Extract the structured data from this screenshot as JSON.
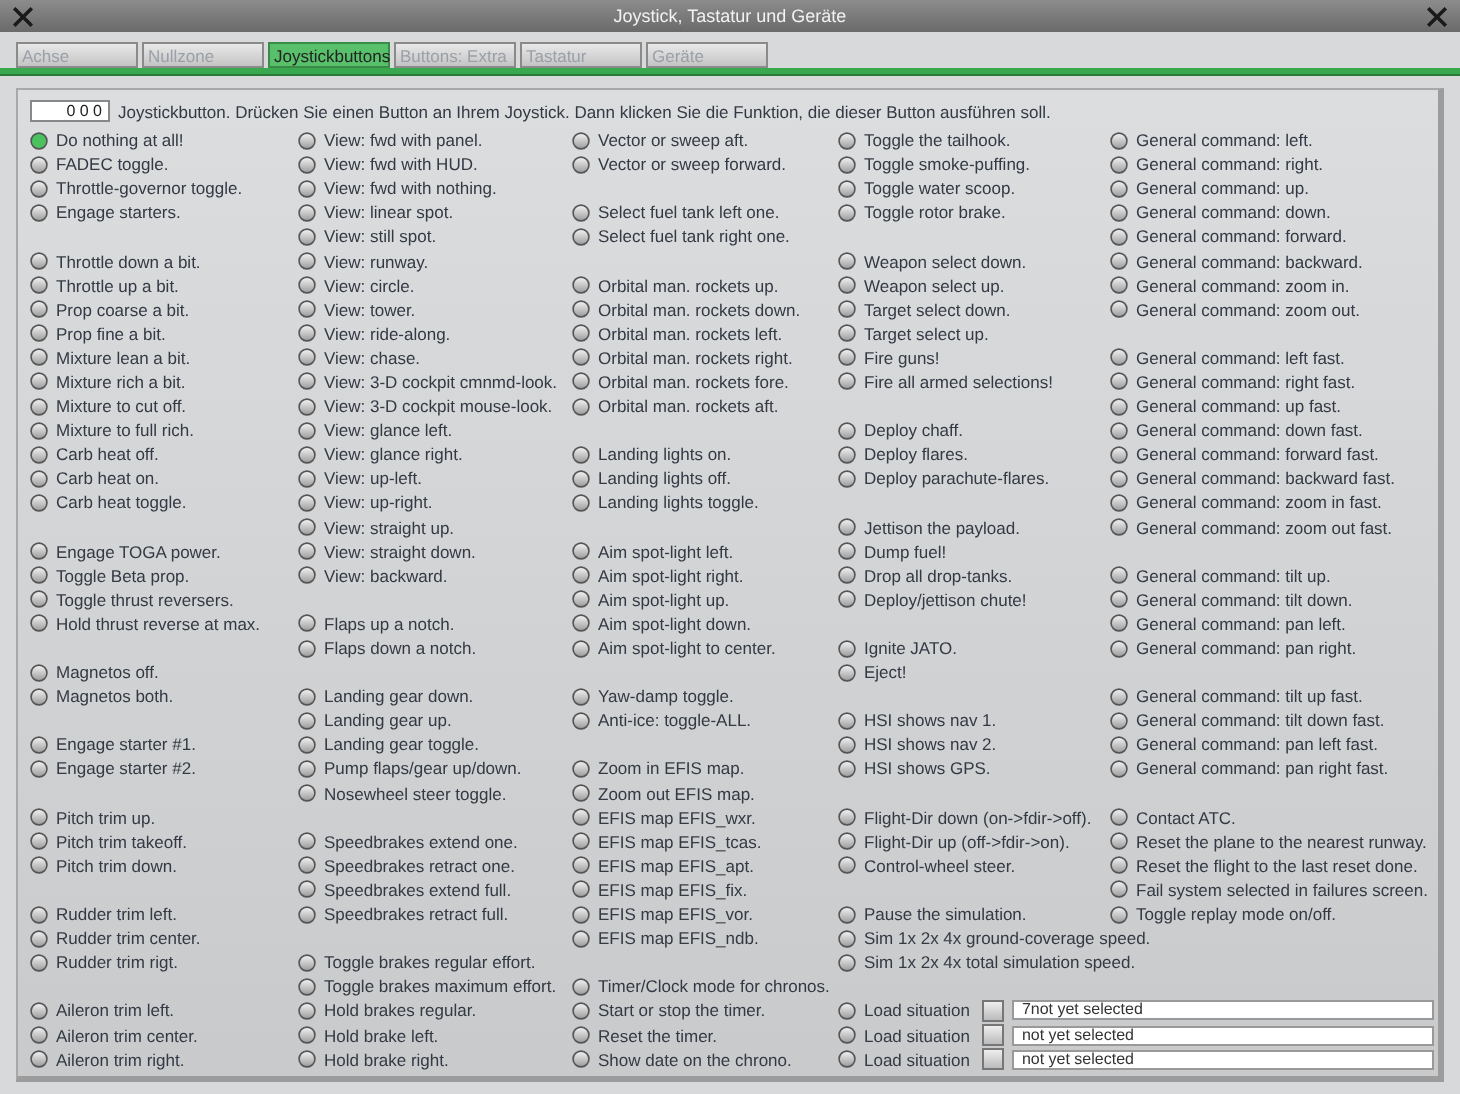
{
  "window": {
    "title": "Joystick, Tastatur und Geräte"
  },
  "tabs": [
    {
      "label": "Achse",
      "selected": false
    },
    {
      "label": "Nullzone",
      "selected": false
    },
    {
      "label": "Joystickbuttons",
      "selected": true
    },
    {
      "label": "Buttons: Extra",
      "selected": false
    },
    {
      "label": "Tastatur",
      "selected": false
    },
    {
      "label": "Geräte",
      "selected": false
    }
  ],
  "button_field": {
    "value": "0 0 0"
  },
  "instruction": "Joystickbutton. Drücken Sie einen Button an Ihrem Joystick. Dann klicken Sie die Funktion, die dieser Button ausführen soll.",
  "columns": [
    {
      "items": [
        {
          "kind": "option",
          "label": "Do nothing at all!",
          "selected": true
        },
        {
          "kind": "option",
          "label": "FADEC toggle.",
          "selected": false
        },
        {
          "kind": "option",
          "label": "Throttle-governor toggle.",
          "selected": false
        },
        {
          "kind": "option",
          "label": "Engage starters.",
          "selected": false
        },
        {
          "kind": "gap"
        },
        {
          "kind": "option",
          "label": "Throttle down a bit.",
          "selected": false
        },
        {
          "kind": "option",
          "label": "Throttle up a bit.",
          "selected": false
        },
        {
          "kind": "option",
          "label": "Prop coarse a bit.",
          "selected": false
        },
        {
          "kind": "option",
          "label": "Prop fine a bit.",
          "selected": false
        },
        {
          "kind": "option",
          "label": "Mixture lean a bit.",
          "selected": false
        },
        {
          "kind": "option",
          "label": "Mixture rich a bit.",
          "selected": false
        },
        {
          "kind": "option",
          "label": "Mixture to cut off.",
          "selected": false
        },
        {
          "kind": "option",
          "label": "Mixture to full rich.",
          "selected": false
        },
        {
          "kind": "option",
          "label": "Carb heat off.",
          "selected": false
        },
        {
          "kind": "option",
          "label": "Carb heat on.",
          "selected": false
        },
        {
          "kind": "option",
          "label": "Carb heat toggle.",
          "selected": false
        },
        {
          "kind": "gap"
        },
        {
          "kind": "option",
          "label": "Engage TOGA power.",
          "selected": false
        },
        {
          "kind": "option",
          "label": "Toggle Beta prop.",
          "selected": false
        },
        {
          "kind": "option",
          "label": "Toggle thrust reversers.",
          "selected": false
        },
        {
          "kind": "option",
          "label": "Hold thrust reverse at max.",
          "selected": false
        },
        {
          "kind": "gap"
        },
        {
          "kind": "option",
          "label": "Magnetos off.",
          "selected": false
        },
        {
          "kind": "option",
          "label": "Magnetos both.",
          "selected": false
        },
        {
          "kind": "gap"
        },
        {
          "kind": "option",
          "label": "Engage starter #1.",
          "selected": false
        },
        {
          "kind": "option",
          "label": "Engage starter #2.",
          "selected": false
        },
        {
          "kind": "gap"
        },
        {
          "kind": "option",
          "label": "Pitch trim up.",
          "selected": false
        },
        {
          "kind": "option",
          "label": "Pitch trim takeoff.",
          "selected": false
        },
        {
          "kind": "option",
          "label": "Pitch trim down.",
          "selected": false
        },
        {
          "kind": "gap"
        },
        {
          "kind": "option",
          "label": "Rudder trim left.",
          "selected": false
        },
        {
          "kind": "option",
          "label": "Rudder trim center.",
          "selected": false
        },
        {
          "kind": "option",
          "label": "Rudder trim rigt.",
          "selected": false
        },
        {
          "kind": "gap"
        },
        {
          "kind": "option",
          "label": "Aileron trim left.",
          "selected": false
        },
        {
          "kind": "option",
          "label": "Aileron trim center.",
          "selected": false
        },
        {
          "kind": "option",
          "label": "Aileron trim right.",
          "selected": false
        }
      ]
    },
    {
      "items": [
        {
          "kind": "option",
          "label": "View: fwd with panel.",
          "selected": false
        },
        {
          "kind": "option",
          "label": "View: fwd with HUD.",
          "selected": false
        },
        {
          "kind": "option",
          "label": "View: fwd with nothing.",
          "selected": false
        },
        {
          "kind": "option",
          "label": "View: linear spot.",
          "selected": false
        },
        {
          "kind": "option",
          "label": "View: still spot.",
          "selected": false
        },
        {
          "kind": "option",
          "label": "View: runway.",
          "selected": false
        },
        {
          "kind": "option",
          "label": "View: circle.",
          "selected": false
        },
        {
          "kind": "option",
          "label": "View: tower.",
          "selected": false
        },
        {
          "kind": "option",
          "label": "View: ride-along.",
          "selected": false
        },
        {
          "kind": "option",
          "label": "View: chase.",
          "selected": false
        },
        {
          "kind": "option",
          "label": "View: 3-D cockpit cmnmd-look.",
          "selected": false
        },
        {
          "kind": "option",
          "label": "View: 3-D cockpit mouse-look.",
          "selected": false
        },
        {
          "kind": "option",
          "label": "View: glance left.",
          "selected": false
        },
        {
          "kind": "option",
          "label": "View: glance right.",
          "selected": false
        },
        {
          "kind": "option",
          "label": "View: up-left.",
          "selected": false
        },
        {
          "kind": "option",
          "label": "View: up-right.",
          "selected": false
        },
        {
          "kind": "option",
          "label": "View: straight up.",
          "selected": false
        },
        {
          "kind": "option",
          "label": "View: straight down.",
          "selected": false
        },
        {
          "kind": "option",
          "label": "View: backward.",
          "selected": false
        },
        {
          "kind": "gap"
        },
        {
          "kind": "option",
          "label": "Flaps up a notch.",
          "selected": false
        },
        {
          "kind": "option",
          "label": "Flaps down a notch.",
          "selected": false
        },
        {
          "kind": "gap"
        },
        {
          "kind": "option",
          "label": "Landing gear down.",
          "selected": false
        },
        {
          "kind": "option",
          "label": "Landing gear up.",
          "selected": false
        },
        {
          "kind": "option",
          "label": "Landing gear toggle.",
          "selected": false
        },
        {
          "kind": "option",
          "label": "Pump flaps/gear up/down.",
          "selected": false
        },
        {
          "kind": "option",
          "label": "Nosewheel steer toggle.",
          "selected": false
        },
        {
          "kind": "gap"
        },
        {
          "kind": "option",
          "label": "Speedbrakes extend one.",
          "selected": false
        },
        {
          "kind": "option",
          "label": "Speedbrakes retract one.",
          "selected": false
        },
        {
          "kind": "option",
          "label": "Speedbrakes extend full.",
          "selected": false
        },
        {
          "kind": "option",
          "label": "Speedbrakes retract full.",
          "selected": false
        },
        {
          "kind": "gap"
        },
        {
          "kind": "option",
          "label": "Toggle brakes regular effort.",
          "selected": false
        },
        {
          "kind": "option",
          "label": "Toggle brakes maximum effort.",
          "selected": false
        },
        {
          "kind": "option",
          "label": "Hold brakes regular.",
          "selected": false
        },
        {
          "kind": "option",
          "label": "Hold brake left.",
          "selected": false
        },
        {
          "kind": "option",
          "label": "Hold brake right.",
          "selected": false
        }
      ]
    },
    {
      "items": [
        {
          "kind": "option",
          "label": "Vector or sweep aft.",
          "selected": false
        },
        {
          "kind": "option",
          "label": "Vector or sweep forward.",
          "selected": false
        },
        {
          "kind": "gap"
        },
        {
          "kind": "option",
          "label": "Select fuel tank left one.",
          "selected": false
        },
        {
          "kind": "option",
          "label": "Select fuel tank right one.",
          "selected": false
        },
        {
          "kind": "gap"
        },
        {
          "kind": "option",
          "label": "Orbital man. rockets up.",
          "selected": false
        },
        {
          "kind": "option",
          "label": "Orbital man. rockets down.",
          "selected": false
        },
        {
          "kind": "option",
          "label": "Orbital man. rockets left.",
          "selected": false
        },
        {
          "kind": "option",
          "label": "Orbital man. rockets right.",
          "selected": false
        },
        {
          "kind": "option",
          "label": "Orbital man. rockets fore.",
          "selected": false
        },
        {
          "kind": "option",
          "label": "Orbital man. rockets aft.",
          "selected": false
        },
        {
          "kind": "gap"
        },
        {
          "kind": "option",
          "label": "Landing lights on.",
          "selected": false
        },
        {
          "kind": "option",
          "label": "Landing lights off.",
          "selected": false
        },
        {
          "kind": "option",
          "label": "Landing lights toggle.",
          "selected": false
        },
        {
          "kind": "gap"
        },
        {
          "kind": "option",
          "label": "Aim spot-light left.",
          "selected": false
        },
        {
          "kind": "option",
          "label": "Aim spot-light right.",
          "selected": false
        },
        {
          "kind": "option",
          "label": "Aim spot-light up.",
          "selected": false
        },
        {
          "kind": "option",
          "label": "Aim spot-light down.",
          "selected": false
        },
        {
          "kind": "option",
          "label": "Aim spot-light to center.",
          "selected": false
        },
        {
          "kind": "gap"
        },
        {
          "kind": "option",
          "label": "Yaw-damp toggle.",
          "selected": false
        },
        {
          "kind": "option",
          "label": "Anti-ice: toggle-ALL.",
          "selected": false
        },
        {
          "kind": "gap"
        },
        {
          "kind": "option",
          "label": "Zoom in EFIS map.",
          "selected": false
        },
        {
          "kind": "option",
          "label": "Zoom out EFIS map.",
          "selected": false
        },
        {
          "kind": "option",
          "label": "EFIS map EFIS_wxr.",
          "selected": false
        },
        {
          "kind": "option",
          "label": "EFIS map EFIS_tcas.",
          "selected": false
        },
        {
          "kind": "option",
          "label": "EFIS map EFIS_apt.",
          "selected": false
        },
        {
          "kind": "option",
          "label": "EFIS map EFIS_fix.",
          "selected": false
        },
        {
          "kind": "option",
          "label": "EFIS map EFIS_vor.",
          "selected": false
        },
        {
          "kind": "option",
          "label": "EFIS map EFIS_ndb.",
          "selected": false
        },
        {
          "kind": "gap"
        },
        {
          "kind": "option",
          "label": "Timer/Clock mode for chronos.",
          "selected": false
        },
        {
          "kind": "option",
          "label": "Start or stop the timer.",
          "selected": false
        },
        {
          "kind": "option",
          "label": "Reset the timer.",
          "selected": false
        },
        {
          "kind": "option",
          "label": "Show date on the chrono.",
          "selected": false
        }
      ]
    },
    {
      "items": [
        {
          "kind": "option",
          "label": "Toggle the tailhook.",
          "selected": false
        },
        {
          "kind": "option",
          "label": "Toggle smoke-puffing.",
          "selected": false
        },
        {
          "kind": "option",
          "label": "Toggle water scoop.",
          "selected": false
        },
        {
          "kind": "option",
          "label": "Toggle rotor brake.",
          "selected": false
        },
        {
          "kind": "gap"
        },
        {
          "kind": "option",
          "label": "Weapon select down.",
          "selected": false
        },
        {
          "kind": "option",
          "label": "Weapon select up.",
          "selected": false
        },
        {
          "kind": "option",
          "label": "Target select down.",
          "selected": false
        },
        {
          "kind": "option",
          "label": "Target select up.",
          "selected": false
        },
        {
          "kind": "option",
          "label": "Fire guns!",
          "selected": false
        },
        {
          "kind": "option",
          "label": "Fire all armed selections!",
          "selected": false
        },
        {
          "kind": "gap"
        },
        {
          "kind": "option",
          "label": "Deploy chaff.",
          "selected": false
        },
        {
          "kind": "option",
          "label": "Deploy flares.",
          "selected": false
        },
        {
          "kind": "option",
          "label": "Deploy parachute-flares.",
          "selected": false
        },
        {
          "kind": "gap"
        },
        {
          "kind": "option",
          "label": "Jettison the payload.",
          "selected": false
        },
        {
          "kind": "option",
          "label": "Dump fuel!",
          "selected": false
        },
        {
          "kind": "option",
          "label": "Drop all drop-tanks.",
          "selected": false
        },
        {
          "kind": "option",
          "label": "Deploy/jettison chute!",
          "selected": false
        },
        {
          "kind": "gap"
        },
        {
          "kind": "option",
          "label": "Ignite JATO.",
          "selected": false
        },
        {
          "kind": "option",
          "label": "Eject!",
          "selected": false
        },
        {
          "kind": "gap"
        },
        {
          "kind": "option",
          "label": "HSI shows nav 1.",
          "selected": false
        },
        {
          "kind": "option",
          "label": "HSI shows nav 2.",
          "selected": false
        },
        {
          "kind": "option",
          "label": "HSI shows GPS.",
          "selected": false
        },
        {
          "kind": "gap"
        },
        {
          "kind": "option",
          "label": "Flight-Dir down (on->fdir->off).",
          "selected": false
        },
        {
          "kind": "option",
          "label": "Flight-Dir up (off->fdir->on).",
          "selected": false
        },
        {
          "kind": "option",
          "label": "Control-wheel steer.",
          "selected": false
        },
        {
          "kind": "gap"
        },
        {
          "kind": "option",
          "label": "Pause the simulation.",
          "selected": false
        },
        {
          "kind": "option",
          "label": "Sim 1x 2x 4x ground-coverage speed.",
          "selected": false
        },
        {
          "kind": "option",
          "label": "Sim 1x 2x 4x total simulation speed.",
          "selected": false
        },
        {
          "kind": "gap"
        },
        {
          "kind": "load",
          "label": "Load situation",
          "selected": false,
          "checked": false,
          "value": "7not yet selected"
        },
        {
          "kind": "load",
          "label": "Load situation",
          "selected": false,
          "checked": false,
          "value": "not yet selected"
        },
        {
          "kind": "load",
          "label": "Load situation",
          "selected": false,
          "checked": false,
          "value": "not yet selected"
        }
      ]
    },
    {
      "items": [
        {
          "kind": "option",
          "label": "General command: left.",
          "selected": false
        },
        {
          "kind": "option",
          "label": "General command: right.",
          "selected": false
        },
        {
          "kind": "option",
          "label": "General command: up.",
          "selected": false
        },
        {
          "kind": "option",
          "label": "General command: down.",
          "selected": false
        },
        {
          "kind": "option",
          "label": "General command: forward.",
          "selected": false
        },
        {
          "kind": "option",
          "label": "General command: backward.",
          "selected": false
        },
        {
          "kind": "option",
          "label": "General command: zoom in.",
          "selected": false
        },
        {
          "kind": "option",
          "label": "General command: zoom out.",
          "selected": false
        },
        {
          "kind": "gap"
        },
        {
          "kind": "option",
          "label": "General command: left fast.",
          "selected": false
        },
        {
          "kind": "option",
          "label": "General command: right fast.",
          "selected": false
        },
        {
          "kind": "option",
          "label": "General command: up fast.",
          "selected": false
        },
        {
          "kind": "option",
          "label": "General command: down fast.",
          "selected": false
        },
        {
          "kind": "option",
          "label": "General command: forward fast.",
          "selected": false
        },
        {
          "kind": "option",
          "label": "General command: backward fast.",
          "selected": false
        },
        {
          "kind": "option",
          "label": "General command: zoom in fast.",
          "selected": false
        },
        {
          "kind": "option",
          "label": "General command: zoom out fast.",
          "selected": false
        },
        {
          "kind": "gap"
        },
        {
          "kind": "option",
          "label": "General command: tilt up.",
          "selected": false
        },
        {
          "kind": "option",
          "label": "General command: tilt down.",
          "selected": false
        },
        {
          "kind": "option",
          "label": "General command: pan left.",
          "selected": false
        },
        {
          "kind": "option",
          "label": "General command: pan right.",
          "selected": false
        },
        {
          "kind": "gap"
        },
        {
          "kind": "option",
          "label": "General command: tilt up fast.",
          "selected": false
        },
        {
          "kind": "option",
          "label": "General command: tilt down fast.",
          "selected": false
        },
        {
          "kind": "option",
          "label": "General command: pan left fast.",
          "selected": false
        },
        {
          "kind": "option",
          "label": "General command: pan right fast.",
          "selected": false
        },
        {
          "kind": "gap"
        },
        {
          "kind": "option",
          "label": "Contact ATC.",
          "selected": false
        },
        {
          "kind": "option",
          "label": "Reset the plane to the nearest runway.",
          "selected": false
        },
        {
          "kind": "option",
          "label": "Reset the flight to the last reset done.",
          "selected": false
        },
        {
          "kind": "option",
          "label": "Fail system selected in failures screen.",
          "selected": false
        },
        {
          "kind": "option",
          "label": "Toggle replay mode on/off.",
          "selected": false
        }
      ]
    }
  ]
}
